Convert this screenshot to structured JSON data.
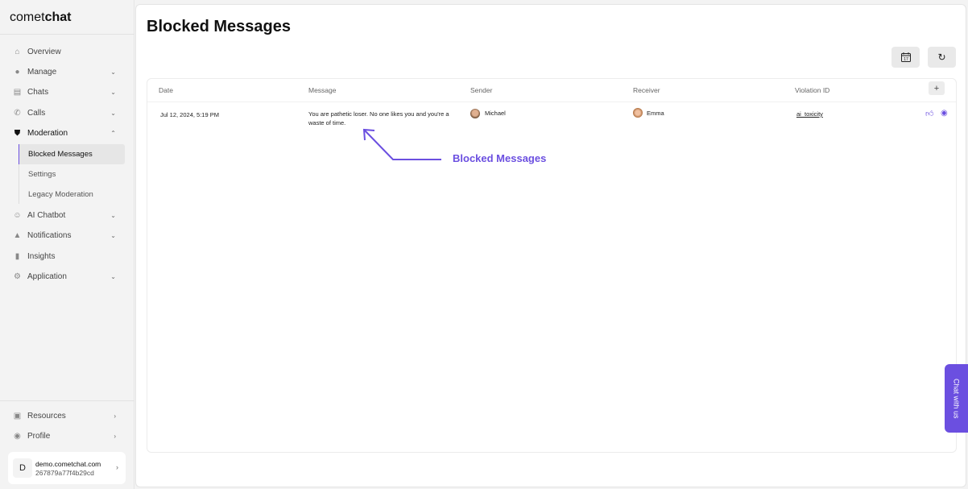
{
  "brand": {
    "logo_light": "comet",
    "logo_bold": "chat"
  },
  "sidebar": {
    "items": [
      {
        "label": "Overview",
        "icon": "home-icon"
      },
      {
        "label": "Manage",
        "icon": "user-icon"
      },
      {
        "label": "Chats",
        "icon": "chat-icon"
      },
      {
        "label": "Calls",
        "icon": "phone-icon"
      },
      {
        "label": "Moderation",
        "icon": "shield-icon"
      },
      {
        "label": "AI Chatbot",
        "icon": "bot-icon"
      },
      {
        "label": "Notifications",
        "icon": "bell-icon"
      },
      {
        "label": "Insights",
        "icon": "bar-chart-icon"
      },
      {
        "label": "Application",
        "icon": "gear-icon"
      }
    ],
    "sub_items": [
      {
        "label": "Blocked Messages"
      },
      {
        "label": "Settings"
      },
      {
        "label": "Legacy Moderation"
      }
    ],
    "bottom": [
      {
        "label": "Resources",
        "icon": "book-icon"
      },
      {
        "label": "Profile",
        "icon": "profile-icon"
      }
    ],
    "account": {
      "initial": "D",
      "domain": "demo.cometchat.com",
      "id": "267879a77f4b29cd"
    }
  },
  "page": {
    "title": "Blocked Messages"
  },
  "table": {
    "headers": [
      "Date",
      "Message",
      "Sender",
      "Receiver",
      "Violation ID"
    ],
    "rows": [
      {
        "date": "Jul 12, 2024, 5:19 PM",
        "message": "You are pathetic loser. No one likes you and you're a waste of time.",
        "sender": "Michael",
        "receiver": "Emma",
        "violation_id": "ai_toxicity"
      }
    ]
  },
  "annotation": {
    "label": "Blocked Messages"
  },
  "chat_widget": {
    "label": "Chat with us"
  },
  "colors": {
    "accent": "#6b4fe0"
  }
}
